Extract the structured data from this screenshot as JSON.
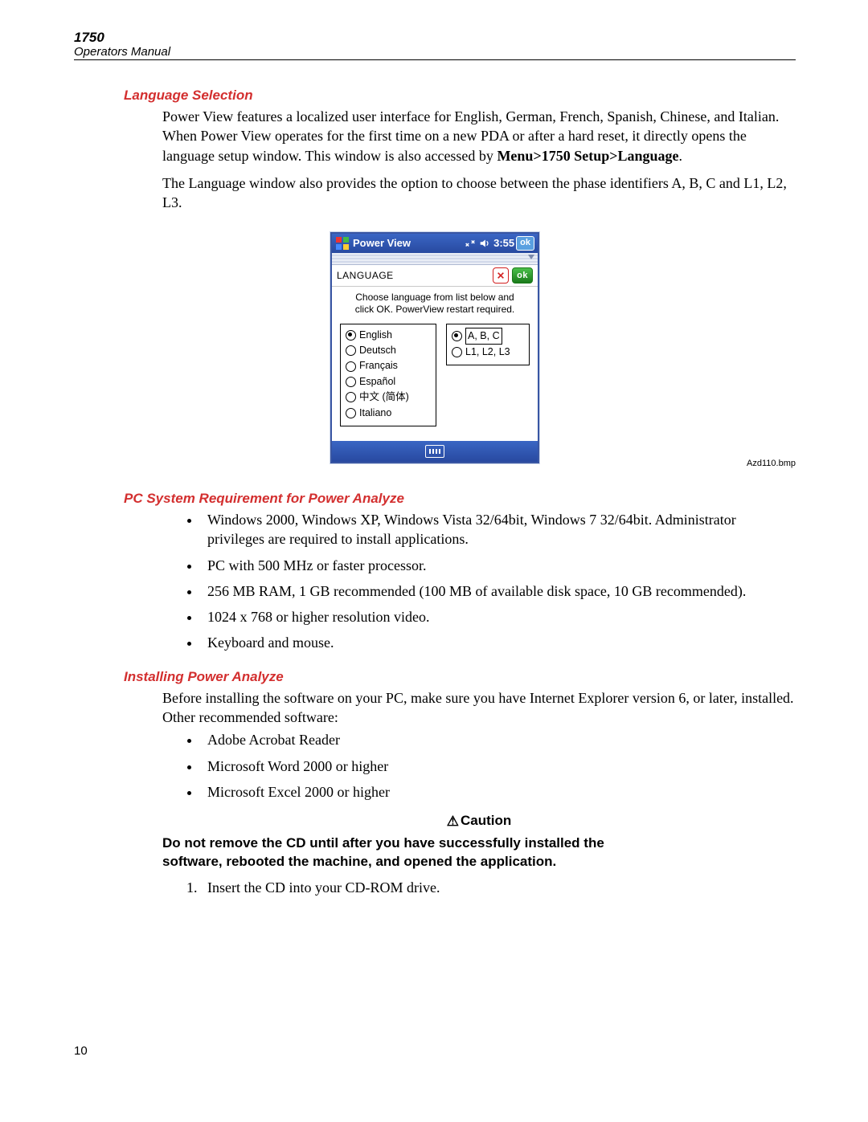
{
  "header": {
    "model": "1750",
    "subtitle": "Operators Manual"
  },
  "page_number": "10",
  "sections": {
    "language_selection": {
      "heading": "Language Selection",
      "para1_a": "Power View features a localized user interface for English, German, French, Spanish, Chinese, and Italian. When Power View operates for the first time on a new PDA or after a hard reset, it directly opens the language setup window. This window is also accessed by ",
      "para1_bold": "Menu>1750 Setup>Language",
      "para1_b": ".",
      "para2": "The Language window also provides the option to choose between the phase identifiers A, B, C and L1, L2, L3."
    },
    "pc_req": {
      "heading": "PC System Requirement for Power Analyze",
      "bullets": [
        "Windows 2000, Windows XP, Windows Vista 32/64bit, Windows 7 32/64bit. Administrator privileges are required to install applications.",
        "PC with 500 MHz or faster processor.",
        "256 MB RAM, 1 GB recommended (100 MB of available disk space, 10 GB recommended).",
        "1024 x 768 or higher resolution video.",
        "Keyboard and mouse."
      ]
    },
    "installing": {
      "heading": "Installing Power Analyze",
      "intro": "Before installing the software on your PC, make sure you have Internet Explorer version 6, or later, installed. Other recommended software:",
      "bullets": [
        "Adobe Acrobat Reader",
        "Microsoft Word 2000 or higher",
        "Microsoft Excel 2000 or higher"
      ],
      "caution_label": "Caution",
      "caution_body": "Do not remove the CD until after you have successfully installed the software, rebooted the machine, and opened the application.",
      "steps": [
        "Insert the CD into your CD-ROM drive."
      ]
    }
  },
  "figure": {
    "caption": "Azd110.bmp",
    "titlebar": {
      "app": "Power View",
      "time": "3:55",
      "ok": "ok"
    },
    "lang_row": {
      "label": "LANGUAGE",
      "ok": "ok"
    },
    "instruction_l1": "Choose language from list below and",
    "instruction_l2": "click OK. PowerView restart required.",
    "languages": [
      "English",
      "Deutsch",
      "Français",
      "Español",
      "中文 (简体)",
      "Italiano"
    ],
    "selected_language_index": 0,
    "phase_options": [
      "A, B, C",
      "L1, L2, L3"
    ],
    "selected_phase_index": 0
  }
}
